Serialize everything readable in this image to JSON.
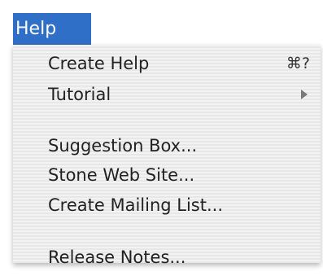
{
  "menu": {
    "title": "Help",
    "items": [
      {
        "label": "Create Help",
        "shortcut": "⌘?"
      },
      {
        "label": "Tutorial",
        "submenu_icon": "submenu-arrow-icon"
      },
      {
        "label": "Suggestion Box..."
      },
      {
        "label": "Stone Web Site..."
      },
      {
        "label": "Create Mailing List..."
      },
      {
        "label": "Release Notes..."
      }
    ]
  },
  "colors": {
    "menu_title_highlight": "#2f6fc8",
    "menu_background": "#eeeeee",
    "text": "#222222"
  }
}
